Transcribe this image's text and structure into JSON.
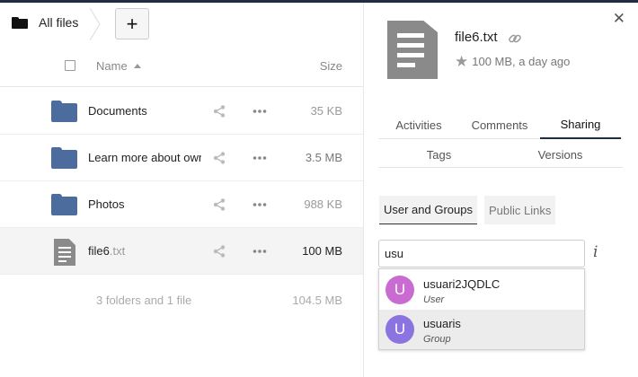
{
  "breadcrumb": {
    "home_label": "All files",
    "add_label": "+"
  },
  "table": {
    "header_name": "Name",
    "header_size": "Size",
    "rows": [
      {
        "kind": "folder",
        "name": "Documents",
        "ext": "",
        "size": "35 KB"
      },
      {
        "kind": "folder",
        "name": "Learn more about ownCloud",
        "ext": "",
        "size": "3.5 MB"
      },
      {
        "kind": "folder",
        "name": "Photos",
        "ext": "",
        "size": "988 KB"
      },
      {
        "kind": "file",
        "name": "file6",
        "ext": ".txt",
        "size": "100 MB"
      }
    ],
    "summary_count": "3 folders and 1 file",
    "summary_size": "104.5 MB"
  },
  "sidebar": {
    "file_name": "file6.txt",
    "file_meta": "100 MB, a day ago",
    "tabs_row1": [
      "Activities",
      "Comments",
      "Sharing"
    ],
    "tabs_row2": [
      "Tags",
      "Versions"
    ],
    "active_tab": "Sharing",
    "subtabs": [
      "User and Groups",
      "Public Links"
    ],
    "share_input_value": "usu",
    "suggestions": [
      {
        "initial": "U",
        "name": "usuari2JQDLC",
        "type": "User",
        "avatar_color": "#c96bd1"
      },
      {
        "initial": "U",
        "name": "usuaris",
        "type": "Group",
        "avatar_color": "#8b73e0"
      }
    ]
  },
  "colors": {
    "folder": "#4b6c9c",
    "doc": "#8a8a8a",
    "topbar": "#1d2d44"
  }
}
